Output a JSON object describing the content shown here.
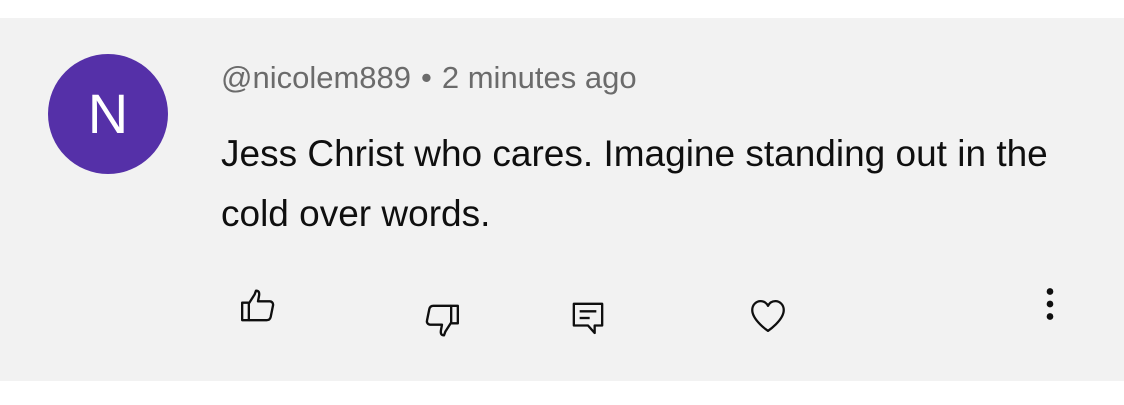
{
  "comment": {
    "avatar_initial": "N",
    "avatar_color": "#5530a8",
    "username": "@nicolem889",
    "separator": "•",
    "timestamp": "2 minutes ago",
    "text": "Jess Christ who cares. Imagine standing out in the cold over words."
  },
  "actions": {
    "like_icon": "thumbs-up-icon",
    "dislike_icon": "thumbs-down-icon",
    "reply_icon": "reply-comment-icon",
    "heart_icon": "heart-icon",
    "more_icon": "more-vertical-icon"
  }
}
